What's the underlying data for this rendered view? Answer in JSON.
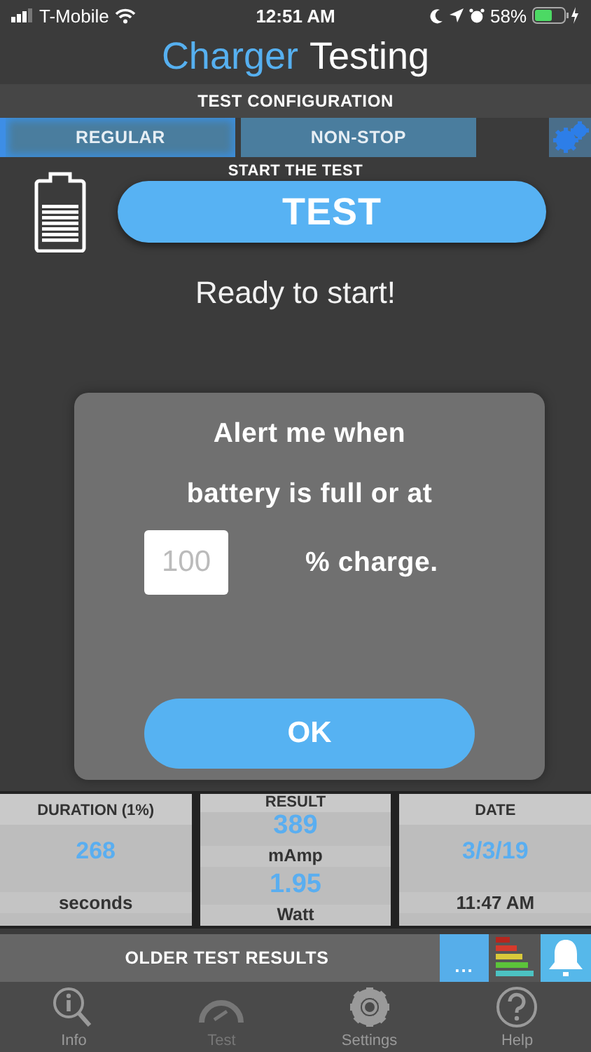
{
  "status_bar": {
    "carrier": "T-Mobile",
    "time": "12:51 AM",
    "battery": "58%"
  },
  "title": {
    "accent": "Charger",
    "rest": "Testing"
  },
  "configuration": {
    "heading": "TEST CONFIGURATION",
    "tabs": [
      {
        "label": "REGULAR",
        "selected": true
      },
      {
        "label": "NON-STOP",
        "selected": false
      }
    ]
  },
  "start": {
    "heading": "START THE TEST",
    "button": "TEST",
    "status": "Ready to start!"
  },
  "alert_dialog": {
    "line_1": "Alert me when",
    "line_2": "battery is full or at",
    "percent_value": "100",
    "percent_suffix": "% charge.",
    "button": "OK"
  },
  "last_test": {
    "columns": [
      {
        "header": "DURATION (1%)",
        "lines": [
          {
            "kind": "value",
            "text": "268"
          },
          {
            "kind": "unit",
            "text": "seconds"
          }
        ]
      },
      {
        "header": "RESULT",
        "lines": [
          {
            "kind": "value",
            "text": "389"
          },
          {
            "kind": "unit",
            "text": "mAmp"
          },
          {
            "kind": "value",
            "text": "1.95"
          },
          {
            "kind": "unit",
            "text": "Watt"
          }
        ]
      },
      {
        "header": "DATE",
        "lines": [
          {
            "kind": "value",
            "text": "3/3/19"
          },
          {
            "kind": "unit",
            "text": "11:47 AM"
          }
        ]
      }
    ]
  },
  "older_results": {
    "label": "OLDER TEST RESULTS",
    "more_button": "..."
  },
  "tab_bar": {
    "items": [
      {
        "label": "Info",
        "kind": "info",
        "selected": false
      },
      {
        "label": "Test",
        "kind": "gauge",
        "selected": true
      },
      {
        "label": "Settings",
        "kind": "gear",
        "selected": false
      },
      {
        "label": "Help",
        "kind": "help",
        "selected": false
      }
    ]
  }
}
